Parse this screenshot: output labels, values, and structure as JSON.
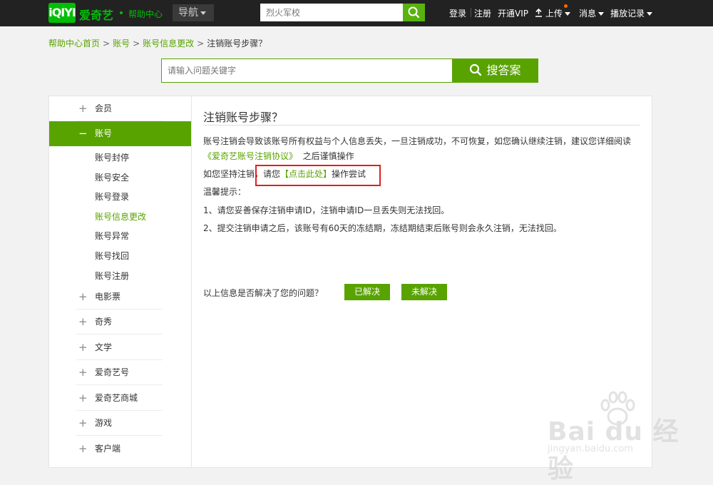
{
  "header": {
    "logo": "iQIYI",
    "brand": "爱奇艺",
    "sub_brand": "帮助中心",
    "nav_label": "导航",
    "search_placeholder": "烈火军校",
    "links": {
      "login": "登录",
      "register": "注册",
      "vip": "开通VIP",
      "upload": "上传",
      "messages": "消息",
      "history": "播放记录"
    }
  },
  "breadcrumb": [
    "帮助中心首页",
    "账号",
    "账号信息更改",
    "注销账号步骤？"
  ],
  "help_search": {
    "placeholder": "请输入问题关键字",
    "button": "搜答案"
  },
  "sidebar": {
    "items": [
      {
        "icon": "plus-icon",
        "label": "会员"
      },
      {
        "icon": "minus-icon",
        "label": "账号"
      },
      {
        "icon": "plus-icon",
        "label": "电影票"
      },
      {
        "icon": "plus-icon",
        "label": "奇秀"
      },
      {
        "icon": "plus-icon",
        "label": "文学"
      },
      {
        "icon": "plus-icon",
        "label": "爱奇艺号"
      },
      {
        "icon": "plus-icon",
        "label": "爱奇艺商城"
      },
      {
        "icon": "plus-icon",
        "label": "游戏"
      },
      {
        "icon": "plus-icon",
        "label": "客户端"
      }
    ],
    "sub_items": [
      "账号封停",
      "账号安全",
      "账号登录",
      "账号信息更改",
      "账号异常",
      "账号找回",
      "账号注册"
    ],
    "selected_sub": "账号信息更改"
  },
  "article": {
    "title": "注销账号步骤？",
    "p1": "账号注销会导致该账号所有权益与个人信息丢失，一旦注销成功，不可恢复，如您确认继续注销，建议您详细阅读",
    "agreement_link": "《爱奇艺账号注销协议》",
    "p1_tail": "之后谨慎操作",
    "p2_prefix": "如您坚持注销，请您",
    "p2_link": "【点击此处】",
    "p2_suffix": "操作尝试",
    "tip_title": "温馨提示：",
    "tip1": "1、请您妥善保存注销申请ID，注销申请ID一旦丢失则无法找回。",
    "tip2": "2、提交注销申请之后，该账号有60天的冻结期，冻结期结束后账号则会永久注销，无法找回。"
  },
  "feedback": {
    "question": "以上信息是否解决了您的问题？",
    "solved": "已解决",
    "unsolved": "未解决"
  },
  "watermark": {
    "text": "Bai du 经验",
    "url": "jingyan.baidu.com"
  },
  "colors": {
    "brand_green": "#00be06",
    "accent_green": "#59a300",
    "topbar_bg": "#222222",
    "highlight_red": "#e02020"
  }
}
